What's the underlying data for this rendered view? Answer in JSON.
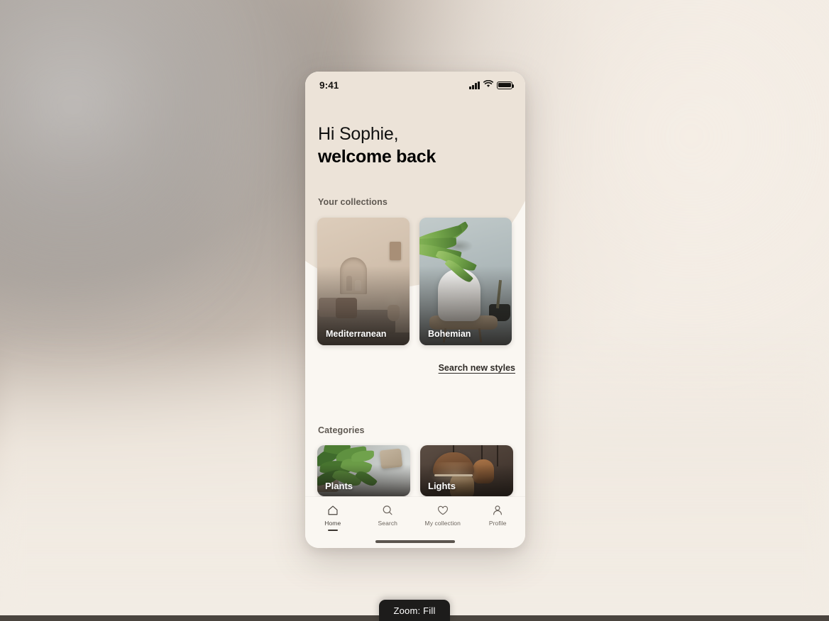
{
  "desktop": {
    "background_colors": {
      "taupe": "#8e867f",
      "cream": "#f2ece4",
      "bottom_strip": "#4a443e"
    }
  },
  "phone": {
    "status_bar": {
      "time": "9:41",
      "icons": [
        "signal-icon",
        "wifi-icon",
        "battery-icon"
      ]
    },
    "greeting": {
      "line1": "Hi Sophie,",
      "line2": "welcome back"
    },
    "collections": {
      "label": "Your collections",
      "cards": [
        {
          "title": "Mediterranean",
          "art": "mediterranean-interior"
        },
        {
          "title": "Bohemian",
          "art": "bohemian-chair-palm"
        }
      ],
      "search_link": "Search new styles"
    },
    "categories": {
      "label": "Categories",
      "cards": [
        {
          "title": "Plants",
          "art": "green-foliage-stone"
        },
        {
          "title": "Lights",
          "art": "copper-pendant-lamps"
        }
      ]
    },
    "tabbar": {
      "items": [
        {
          "label": "Home",
          "icon": "home-icon",
          "active": true
        },
        {
          "label": "Search",
          "icon": "search-icon",
          "active": false
        },
        {
          "label": "My collection",
          "icon": "heart-icon",
          "active": false
        },
        {
          "label": "Profile",
          "icon": "person-icon",
          "active": false
        }
      ]
    }
  },
  "toast": {
    "text": "Zoom: Fill"
  }
}
